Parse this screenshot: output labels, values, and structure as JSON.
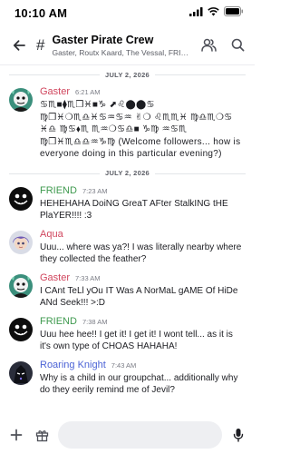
{
  "status": {
    "time": "10:10 AM"
  },
  "header": {
    "channel": "Gaster Pirate Crew",
    "members": "Gaster, Routx Kaard, The Vessal, FRIEND, Ro..."
  },
  "messages": [
    {
      "type": "divider",
      "label": "JULY 2, 2026"
    },
    {
      "type": "message",
      "author": "Gaster",
      "color": "#d0455d",
      "time": "6:21 AM",
      "avatar": "gaster",
      "text": "♋︎♏︎■︎⧫︎♏︎❒︎♓︎■︎♑︎ ⬈︎♌︎⬤︎⬤︎♋︎ ♍︎❒︎♓︎❍︎♏︎♎︎♓︎♋︎♒︎♋︎♒︎ ✌︎❍︎ ♌︎♏︎♏︎♓︎ ♍︎♎︎♏︎❍︎♋︎ ♓︎♎︎ ♍︎♋︎⬧︎♏︎ ♏︎♒︎❍︎♋︎♎︎■︎ ♑︎♍︎ ♒︎♋︎♏︎ ♍︎❒︎♓︎♏︎♎︎♎︎♒︎♑︎♍︎ (Welcome followers... how is everyone doing in this particular evening?)"
    },
    {
      "type": "divider",
      "label": "JULY 2, 2026"
    },
    {
      "type": "message",
      "author": "FRIEND",
      "color": "#3f9a4f",
      "time": "7:23 AM",
      "avatar": "friend",
      "text": "HEHEHAHA DoiNG GreaT AFter StalkING tHE PlaYER!!!! :3"
    },
    {
      "type": "message",
      "author": "Aqua",
      "color": "#d0455d",
      "time": "",
      "avatar": "aqua",
      "text": "Uuu... where was ya?! I was literally nearby where they collected the feather?"
    },
    {
      "type": "message",
      "author": "Gaster",
      "color": "#d0455d",
      "time": "7:33 AM",
      "avatar": "gaster",
      "text": "I CAnt TeLl yOu IT Was A NorMaL gAME Of HiDe ANd Seek!!! >:D"
    },
    {
      "type": "message",
      "author": "FRIEND",
      "color": "#3f9a4f",
      "time": "7:38 AM",
      "avatar": "friend",
      "text": "Uuu hee hee!! I get it! I get it! I wont tell... as it is it's own type of CHOAS HAHAHA!"
    },
    {
      "type": "message",
      "author": "Roaring Knight",
      "color": "#4c63d6",
      "time": "7:43 AM",
      "avatar": "knight",
      "text": "Why is a child in our groupchat... additionally why do they eerily remind me of Jevil?"
    }
  ]
}
